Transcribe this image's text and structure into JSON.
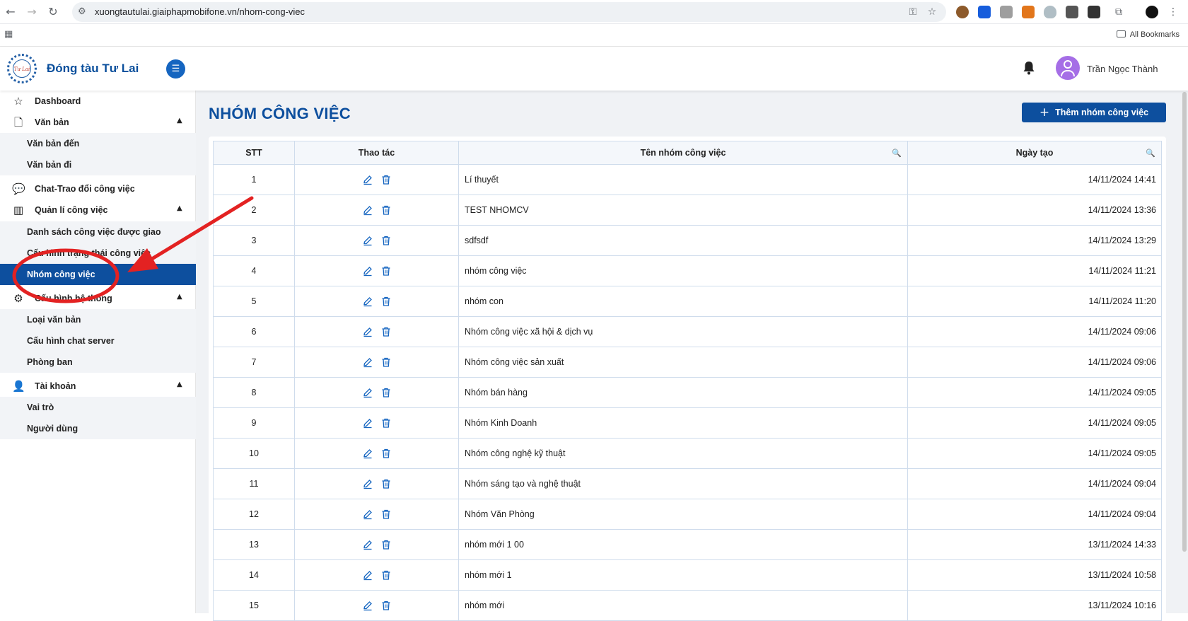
{
  "browser": {
    "url": "xuongtautulai.giaiphapmobifone.vn/nhom-cong-viec",
    "bookmarks_label": "All Bookmarks"
  },
  "header": {
    "brand": "Đóng tàu Tư Lai",
    "username": "Trần Ngọc Thành"
  },
  "sidebar": {
    "dashboard": "Dashboard",
    "van_ban": "Văn bản",
    "van_ban_den": "Văn bản đến",
    "van_ban_di": "Văn bản đi",
    "chat": "Chat-Trao đổi công việc",
    "quan_li": "Quản lí công việc",
    "danh_sach": "Danh sách công việc được giao",
    "cau_hinh_trang_thai": "Cấu hình trạng thái công việc",
    "nhom_cong_viec": "Nhóm công việc",
    "cau_hinh_he_thong": "Cấu hình hệ thống",
    "loai_van_ban": "Loại văn bản",
    "chat_server": "Cấu hình chat server",
    "phong_ban": "Phòng ban",
    "tai_khoan": "Tài khoản",
    "vai_tro": "Vai trò",
    "nguoi_dung": "Người dùng"
  },
  "main": {
    "title": "NHÓM CÔNG VIỆC",
    "add_button": "Thêm nhóm công việc",
    "columns": {
      "stt": "STT",
      "actions": "Thao tác",
      "name": "Tên nhóm công việc",
      "created": "Ngày tạo"
    },
    "rows": [
      {
        "stt": "1",
        "name": "Lí thuyết",
        "created": "14/11/2024 14:41"
      },
      {
        "stt": "2",
        "name": "TEST NHOMCV",
        "created": "14/11/2024 13:36"
      },
      {
        "stt": "3",
        "name": "sdfsdf",
        "created": "14/11/2024 13:29"
      },
      {
        "stt": "4",
        "name": "nhóm công việc",
        "created": "14/11/2024 11:21"
      },
      {
        "stt": "5",
        "name": "nhóm con",
        "created": "14/11/2024 11:20"
      },
      {
        "stt": "6",
        "name": "Nhóm công việc xã hội & dịch vụ",
        "created": "14/11/2024 09:06"
      },
      {
        "stt": "7",
        "name": "Nhóm công việc sản xuất",
        "created": "14/11/2024 09:06"
      },
      {
        "stt": "8",
        "name": "Nhóm bán hàng",
        "created": "14/11/2024 09:05"
      },
      {
        "stt": "9",
        "name": "Nhóm Kinh Doanh",
        "created": "14/11/2024 09:05"
      },
      {
        "stt": "10",
        "name": "Nhóm công nghệ kỹ thuật",
        "created": "14/11/2024 09:05"
      },
      {
        "stt": "11",
        "name": "Nhóm sáng tạo và nghệ thuật",
        "created": "14/11/2024 09:04"
      },
      {
        "stt": "12",
        "name": "Nhóm Văn Phòng",
        "created": "14/11/2024 09:04"
      },
      {
        "stt": "13",
        "name": "nhóm mới 1 00",
        "created": "13/11/2024 14:33"
      },
      {
        "stt": "14",
        "name": "nhóm mới 1",
        "created": "13/11/2024 10:58"
      },
      {
        "stt": "15",
        "name": "nhóm mới",
        "created": "13/11/2024 10:16"
      }
    ]
  },
  "colors": {
    "primary": "#0d4f9e",
    "annotation": "#e32222"
  }
}
